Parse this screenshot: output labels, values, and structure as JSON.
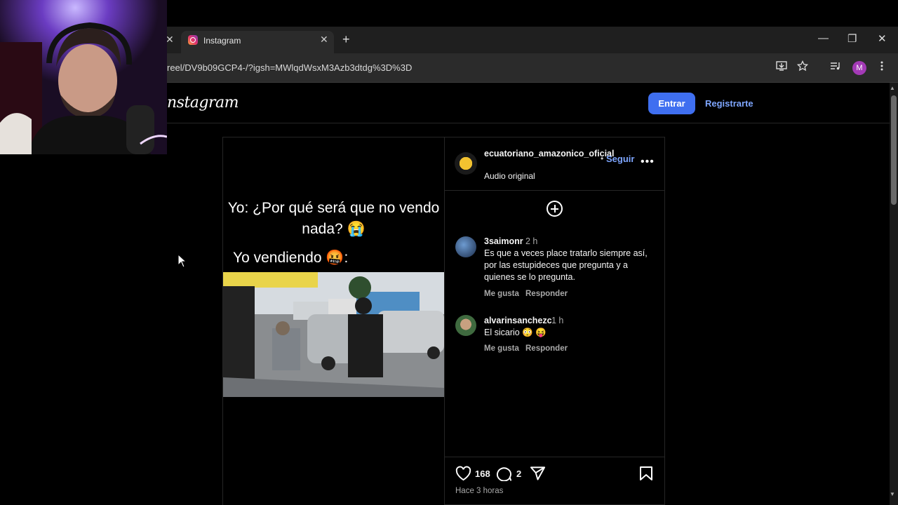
{
  "browser": {
    "tab_title": "Instagram",
    "tab_close": "✕",
    "prev_tab_close": "✕",
    "new_tab": "+",
    "url": "reel/DV9b09GCP4-/?igsh=MWlqdWsxM3Azb3dtdg%3D%3D",
    "profile_initial": "M",
    "window_buttons": {
      "minimize": "—",
      "restore": "❐",
      "close": "✕"
    }
  },
  "instagram": {
    "logo": "nstagram",
    "login_label": "Entrar",
    "signup_label": "Registrarte"
  },
  "post": {
    "caption_line1": "Yo: ¿Por qué será que no vendo nada? 😭",
    "caption_line2": "Yo vendiendo 🤬:",
    "author": "ecuatoriano_amazonico_oficial",
    "follow_separator": "•",
    "follow_label": "Seguir",
    "audio_label": "Audio original",
    "more_label": "•••",
    "likes": "168",
    "comments_count": "2",
    "time_ago": "Hace 3 horas"
  },
  "comments": [
    {
      "user": "3saimonr",
      "time": "2 h",
      "text": "Es que a veces place tratarlo siempre así, por las estupideces que pregunta y a quienes se lo pregunta.",
      "like_label": "Me gusta",
      "reply_label": "Responder"
    },
    {
      "user": "alvarinsanchezc",
      "time": "1 h",
      "text": "El sicario 😳 😝",
      "like_label": "Me gusta",
      "reply_label": "Responder"
    }
  ],
  "colors": {
    "accent_blue": "#3f6ff0",
    "link_blue": "#7ea6ff",
    "background": "#000000"
  }
}
